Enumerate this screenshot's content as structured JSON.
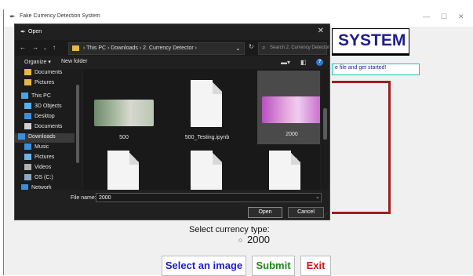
{
  "app": {
    "window_title": "Fake Currency Detection System",
    "heading": "SYSTEM",
    "hint": "e file and get started!",
    "select_label": "Select currency type:",
    "radio_option": "2000",
    "buttons": {
      "select_image": "Select an image",
      "submit": "Submit",
      "exit": "Exit"
    }
  },
  "dialog": {
    "title": "Open",
    "breadcrumbs": "›  This PC  ›  Downloads  ›  2. Currency Detector  ›",
    "search_placeholder": "Search 2. Currency Detector",
    "toolbar": {
      "organize": "Organize ▾",
      "new_folder": "New folder"
    },
    "nav_items": [
      {
        "label": "Documents",
        "icon": "folder-icon",
        "color": "#e7b847"
      },
      {
        "label": "Pictures",
        "icon": "folder-icon",
        "color": "#e7b847"
      },
      {
        "label": "This PC",
        "icon": "computer-icon",
        "color": "#4aa3e8"
      },
      {
        "label": "3D Objects",
        "icon": "cube-icon",
        "color": "#5ab0f0"
      },
      {
        "label": "Desktop",
        "icon": "desktop-icon",
        "color": "#3b8fd9"
      },
      {
        "label": "Documents",
        "icon": "documents-icon",
        "color": "#cfcfcf"
      },
      {
        "label": "Downloads",
        "icon": "download-icon",
        "color": "#3b8fd9"
      },
      {
        "label": "Music",
        "icon": "music-icon",
        "color": "#3b8fd9"
      },
      {
        "label": "Pictures",
        "icon": "pictures-icon",
        "color": "#6bb3e8"
      },
      {
        "label": "Videos",
        "icon": "videos-icon",
        "color": "#b0b0b0"
      },
      {
        "label": "OS (C:)",
        "icon": "drive-icon",
        "color": "#8aa9c8"
      },
      {
        "label": "Network",
        "icon": "network-icon",
        "color": "#3b8fd9"
      }
    ],
    "files": [
      {
        "name": "500",
        "type": "image"
      },
      {
        "name": "500_Testing.ipynb",
        "type": "document"
      },
      {
        "name": "2000",
        "type": "image"
      },
      {
        "name": "",
        "type": "document"
      },
      {
        "name": "",
        "type": "document"
      },
      {
        "name": "",
        "type": "document"
      }
    ],
    "file_name_label": "File name:",
    "file_name_value": "2000",
    "open_button": "Open",
    "cancel_button": "Cancel"
  }
}
